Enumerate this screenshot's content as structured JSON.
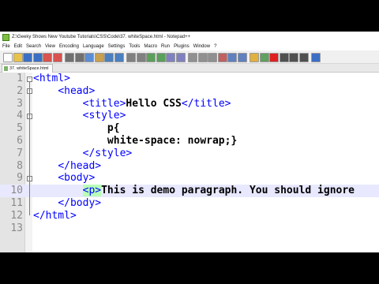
{
  "window": {
    "title": "Z:\\Geeky Shows New Youtube Tutorials\\CSS\\Code\\37. whiteSpace.html - Notepad++"
  },
  "menu": [
    "File",
    "Edit",
    "Search",
    "View",
    "Encoding",
    "Language",
    "Settings",
    "Tools",
    "Macro",
    "Run",
    "Plugins",
    "Window",
    "?"
  ],
  "toolbar_icons": [
    {
      "name": "new-file-icon",
      "color": "#ffffff"
    },
    {
      "name": "open-file-icon",
      "color": "#e8c24a"
    },
    {
      "name": "save-icon",
      "color": "#3b6fc4"
    },
    {
      "name": "save-all-icon",
      "color": "#3b6fc4"
    },
    {
      "name": "close-icon",
      "color": "#d9534f"
    },
    {
      "name": "close-all-icon",
      "color": "#d9534f"
    },
    {
      "name": "print-icon",
      "color": "#707070"
    },
    {
      "name": "cut-icon",
      "color": "#707070"
    },
    {
      "name": "copy-icon",
      "color": "#5b8dd6"
    },
    {
      "name": "paste-icon",
      "color": "#c8a050"
    },
    {
      "name": "undo-icon",
      "color": "#4a7fc0"
    },
    {
      "name": "redo-icon",
      "color": "#4a7fc0"
    },
    {
      "name": "find-icon",
      "color": "#808080"
    },
    {
      "name": "replace-icon",
      "color": "#808080"
    },
    {
      "name": "zoom-in-icon",
      "color": "#5aa05a"
    },
    {
      "name": "zoom-out-icon",
      "color": "#5aa05a"
    },
    {
      "name": "sync-vertical-icon",
      "color": "#8080c0"
    },
    {
      "name": "sync-horizontal-icon",
      "color": "#8080c0"
    },
    {
      "name": "word-wrap-icon",
      "color": "#909090"
    },
    {
      "name": "show-all-chars-icon",
      "color": "#909090"
    },
    {
      "name": "indent-guide-icon",
      "color": "#909090"
    },
    {
      "name": "language-icon",
      "color": "#c06060"
    },
    {
      "name": "doc-map-icon",
      "color": "#6080c0"
    },
    {
      "name": "function-list-icon",
      "color": "#6080c0"
    },
    {
      "name": "folder-workspace-icon",
      "color": "#e0b040"
    },
    {
      "name": "monitoring-icon",
      "color": "#60a060"
    },
    {
      "name": "record-macro-icon",
      "color": "#e02020"
    },
    {
      "name": "stop-macro-icon",
      "color": "#505050"
    },
    {
      "name": "play-macro-icon",
      "color": "#505050"
    },
    {
      "name": "run-macro-multiple-icon",
      "color": "#505050"
    },
    {
      "name": "save-macro-icon",
      "color": "#3b6fc4"
    }
  ],
  "tab": {
    "label": "37. whiteSpace.html"
  },
  "colors": {
    "tag": "#0000ff",
    "text": "#000000",
    "active_line": "#e8e8ff",
    "gutter": "#e4e4e4"
  },
  "lines": [
    {
      "num": "1",
      "parts": [
        {
          "t": "<html>",
          "c": "tag"
        }
      ]
    },
    {
      "num": "2",
      "parts": [
        {
          "t": "    "
        },
        {
          "t": "<head>",
          "c": "tag"
        }
      ]
    },
    {
      "num": "3",
      "parts": [
        {
          "t": "        "
        },
        {
          "t": "<title>",
          "c": "tag"
        },
        {
          "t": "Hello CSS",
          "c": "txt"
        },
        {
          "t": "</title>",
          "c": "tag"
        }
      ]
    },
    {
      "num": "4",
      "parts": [
        {
          "t": "        "
        },
        {
          "t": "<style>",
          "c": "tag"
        }
      ]
    },
    {
      "num": "5",
      "parts": [
        {
          "t": "            "
        },
        {
          "t": "p{",
          "c": "txt"
        }
      ]
    },
    {
      "num": "6",
      "parts": [
        {
          "t": "            "
        },
        {
          "t": "white-space: nowrap;}",
          "c": "txt"
        }
      ]
    },
    {
      "num": "7",
      "parts": [
        {
          "t": "        "
        },
        {
          "t": "</style>",
          "c": "tag"
        }
      ]
    },
    {
      "num": "8",
      "parts": [
        {
          "t": "    "
        },
        {
          "t": "</head>",
          "c": "tag"
        }
      ]
    },
    {
      "num": "9",
      "parts": [
        {
          "t": "    "
        },
        {
          "t": "<body>",
          "c": "tag"
        }
      ]
    },
    {
      "num": "10",
      "active": true,
      "parts": [
        {
          "t": "        "
        },
        {
          "t": "<p>",
          "c": "tag-hl"
        },
        {
          "t": "This is demo paragraph. You should ignore",
          "c": "txt"
        }
      ]
    },
    {
      "num": "11",
      "parts": [
        {
          "t": "    "
        },
        {
          "t": "</body>",
          "c": "tag"
        }
      ]
    },
    {
      "num": "12",
      "parts": [
        {
          "t": "</html>",
          "c": "tag"
        }
      ]
    },
    {
      "num": "13",
      "parts": []
    }
  ]
}
